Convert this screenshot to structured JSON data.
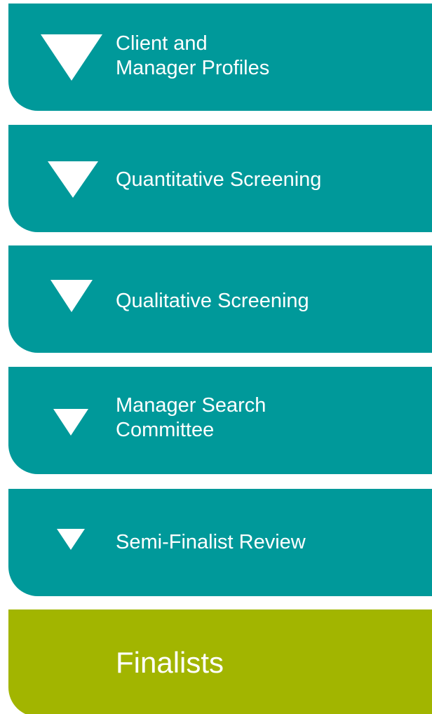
{
  "stages": [
    {
      "label": "Client and\nManager Profiles"
    },
    {
      "label": "Quantitative Screening"
    },
    {
      "label": "Qualitative Screening"
    },
    {
      "label": "Manager Search\nCommittee"
    },
    {
      "label": "Semi-Finalist Review"
    },
    {
      "label": "Finalists"
    }
  ],
  "colors": {
    "stage_teal": "#00999a",
    "final_green": "#a2b500",
    "text": "#ffffff"
  }
}
